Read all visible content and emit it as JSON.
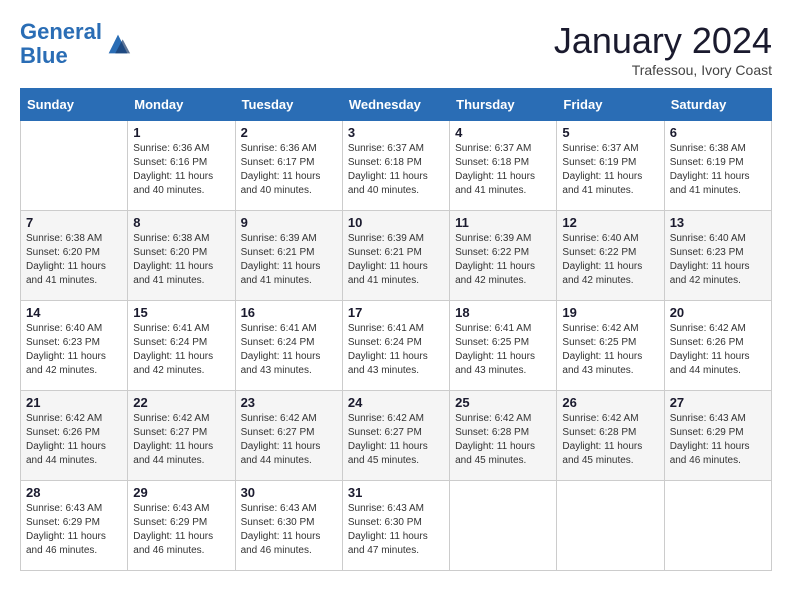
{
  "header": {
    "logo_line1": "General",
    "logo_line2": "Blue",
    "month_title": "January 2024",
    "subtitle": "Trafessou, Ivory Coast"
  },
  "days_of_week": [
    "Sunday",
    "Monday",
    "Tuesday",
    "Wednesday",
    "Thursday",
    "Friday",
    "Saturday"
  ],
  "weeks": [
    [
      {
        "day": "",
        "sunrise": "",
        "sunset": "",
        "daylight": ""
      },
      {
        "day": "1",
        "sunrise": "Sunrise: 6:36 AM",
        "sunset": "Sunset: 6:16 PM",
        "daylight": "Daylight: 11 hours and 40 minutes."
      },
      {
        "day": "2",
        "sunrise": "Sunrise: 6:36 AM",
        "sunset": "Sunset: 6:17 PM",
        "daylight": "Daylight: 11 hours and 40 minutes."
      },
      {
        "day": "3",
        "sunrise": "Sunrise: 6:37 AM",
        "sunset": "Sunset: 6:18 PM",
        "daylight": "Daylight: 11 hours and 40 minutes."
      },
      {
        "day": "4",
        "sunrise": "Sunrise: 6:37 AM",
        "sunset": "Sunset: 6:18 PM",
        "daylight": "Daylight: 11 hours and 41 minutes."
      },
      {
        "day": "5",
        "sunrise": "Sunrise: 6:37 AM",
        "sunset": "Sunset: 6:19 PM",
        "daylight": "Daylight: 11 hours and 41 minutes."
      },
      {
        "day": "6",
        "sunrise": "Sunrise: 6:38 AM",
        "sunset": "Sunset: 6:19 PM",
        "daylight": "Daylight: 11 hours and 41 minutes."
      }
    ],
    [
      {
        "day": "7",
        "sunrise": "Sunrise: 6:38 AM",
        "sunset": "Sunset: 6:20 PM",
        "daylight": "Daylight: 11 hours and 41 minutes."
      },
      {
        "day": "8",
        "sunrise": "Sunrise: 6:38 AM",
        "sunset": "Sunset: 6:20 PM",
        "daylight": "Daylight: 11 hours and 41 minutes."
      },
      {
        "day": "9",
        "sunrise": "Sunrise: 6:39 AM",
        "sunset": "Sunset: 6:21 PM",
        "daylight": "Daylight: 11 hours and 41 minutes."
      },
      {
        "day": "10",
        "sunrise": "Sunrise: 6:39 AM",
        "sunset": "Sunset: 6:21 PM",
        "daylight": "Daylight: 11 hours and 41 minutes."
      },
      {
        "day": "11",
        "sunrise": "Sunrise: 6:39 AM",
        "sunset": "Sunset: 6:22 PM",
        "daylight": "Daylight: 11 hours and 42 minutes."
      },
      {
        "day": "12",
        "sunrise": "Sunrise: 6:40 AM",
        "sunset": "Sunset: 6:22 PM",
        "daylight": "Daylight: 11 hours and 42 minutes."
      },
      {
        "day": "13",
        "sunrise": "Sunrise: 6:40 AM",
        "sunset": "Sunset: 6:23 PM",
        "daylight": "Daylight: 11 hours and 42 minutes."
      }
    ],
    [
      {
        "day": "14",
        "sunrise": "Sunrise: 6:40 AM",
        "sunset": "Sunset: 6:23 PM",
        "daylight": "Daylight: 11 hours and 42 minutes."
      },
      {
        "day": "15",
        "sunrise": "Sunrise: 6:41 AM",
        "sunset": "Sunset: 6:24 PM",
        "daylight": "Daylight: 11 hours and 42 minutes."
      },
      {
        "day": "16",
        "sunrise": "Sunrise: 6:41 AM",
        "sunset": "Sunset: 6:24 PM",
        "daylight": "Daylight: 11 hours and 43 minutes."
      },
      {
        "day": "17",
        "sunrise": "Sunrise: 6:41 AM",
        "sunset": "Sunset: 6:24 PM",
        "daylight": "Daylight: 11 hours and 43 minutes."
      },
      {
        "day": "18",
        "sunrise": "Sunrise: 6:41 AM",
        "sunset": "Sunset: 6:25 PM",
        "daylight": "Daylight: 11 hours and 43 minutes."
      },
      {
        "day": "19",
        "sunrise": "Sunrise: 6:42 AM",
        "sunset": "Sunset: 6:25 PM",
        "daylight": "Daylight: 11 hours and 43 minutes."
      },
      {
        "day": "20",
        "sunrise": "Sunrise: 6:42 AM",
        "sunset": "Sunset: 6:26 PM",
        "daylight": "Daylight: 11 hours and 44 minutes."
      }
    ],
    [
      {
        "day": "21",
        "sunrise": "Sunrise: 6:42 AM",
        "sunset": "Sunset: 6:26 PM",
        "daylight": "Daylight: 11 hours and 44 minutes."
      },
      {
        "day": "22",
        "sunrise": "Sunrise: 6:42 AM",
        "sunset": "Sunset: 6:27 PM",
        "daylight": "Daylight: 11 hours and 44 minutes."
      },
      {
        "day": "23",
        "sunrise": "Sunrise: 6:42 AM",
        "sunset": "Sunset: 6:27 PM",
        "daylight": "Daylight: 11 hours and 44 minutes."
      },
      {
        "day": "24",
        "sunrise": "Sunrise: 6:42 AM",
        "sunset": "Sunset: 6:27 PM",
        "daylight": "Daylight: 11 hours and 45 minutes."
      },
      {
        "day": "25",
        "sunrise": "Sunrise: 6:42 AM",
        "sunset": "Sunset: 6:28 PM",
        "daylight": "Daylight: 11 hours and 45 minutes."
      },
      {
        "day": "26",
        "sunrise": "Sunrise: 6:42 AM",
        "sunset": "Sunset: 6:28 PM",
        "daylight": "Daylight: 11 hours and 45 minutes."
      },
      {
        "day": "27",
        "sunrise": "Sunrise: 6:43 AM",
        "sunset": "Sunset: 6:29 PM",
        "daylight": "Daylight: 11 hours and 46 minutes."
      }
    ],
    [
      {
        "day": "28",
        "sunrise": "Sunrise: 6:43 AM",
        "sunset": "Sunset: 6:29 PM",
        "daylight": "Daylight: 11 hours and 46 minutes."
      },
      {
        "day": "29",
        "sunrise": "Sunrise: 6:43 AM",
        "sunset": "Sunset: 6:29 PM",
        "daylight": "Daylight: 11 hours and 46 minutes."
      },
      {
        "day": "30",
        "sunrise": "Sunrise: 6:43 AM",
        "sunset": "Sunset: 6:30 PM",
        "daylight": "Daylight: 11 hours and 46 minutes."
      },
      {
        "day": "31",
        "sunrise": "Sunrise: 6:43 AM",
        "sunset": "Sunset: 6:30 PM",
        "daylight": "Daylight: 11 hours and 47 minutes."
      },
      {
        "day": "",
        "sunrise": "",
        "sunset": "",
        "daylight": ""
      },
      {
        "day": "",
        "sunrise": "",
        "sunset": "",
        "daylight": ""
      },
      {
        "day": "",
        "sunrise": "",
        "sunset": "",
        "daylight": ""
      }
    ]
  ]
}
